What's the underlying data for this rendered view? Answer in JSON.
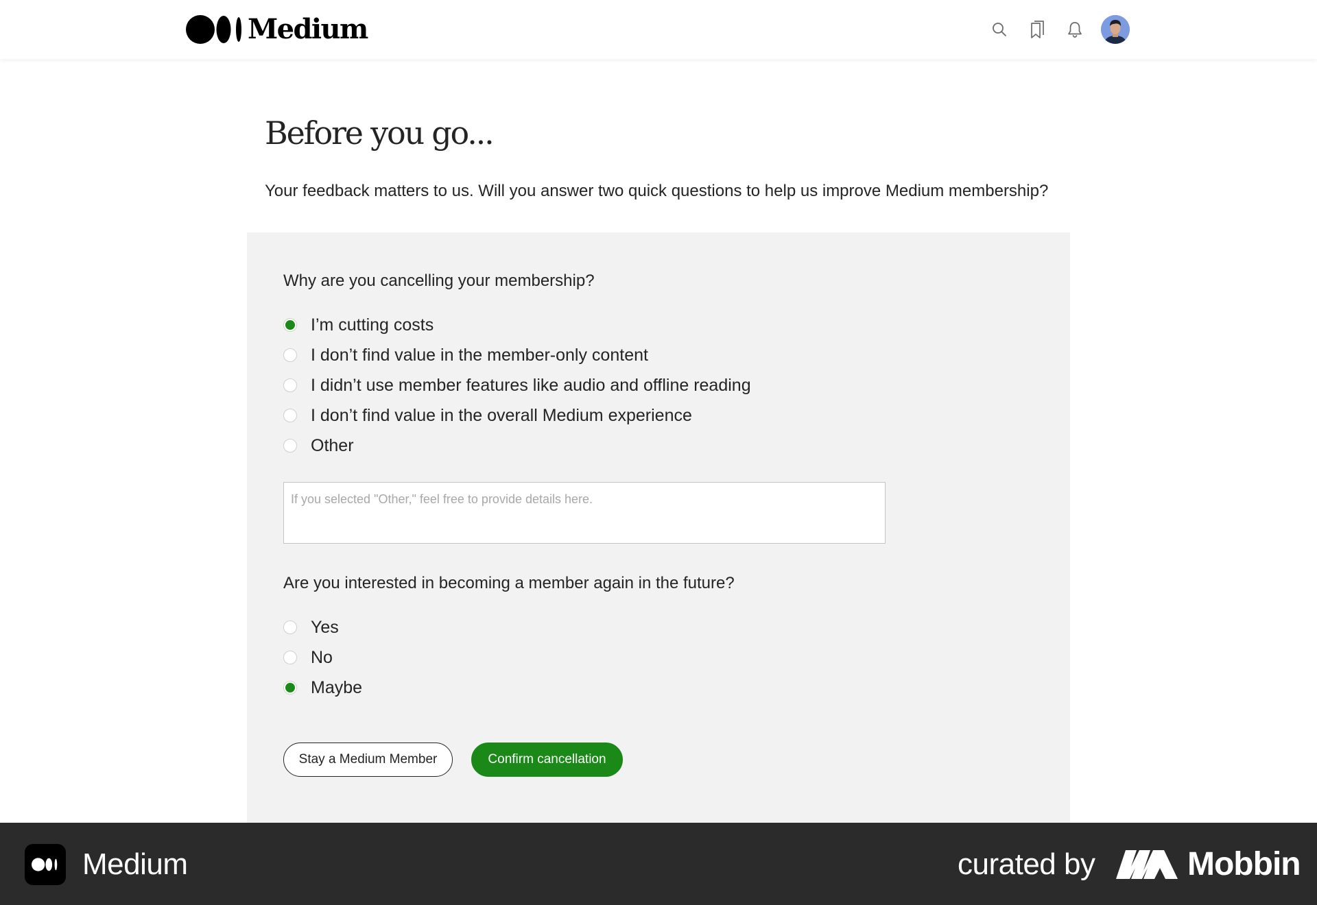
{
  "header": {
    "brand": "Medium",
    "icons": [
      "medium-logo-icon",
      "search-icon",
      "bookmarks-icon",
      "notification-bell-icon",
      "avatar"
    ]
  },
  "page": {
    "title": "Before you go...",
    "intro": "Your feedback matters to us. Will you answer two quick questions to help us improve Medium membership?"
  },
  "survey": {
    "q1": {
      "question": "Why are you cancelling your membership?",
      "options": [
        "I’m cutting costs",
        "I don’t find value in the member-only content",
        "I didn’t use member features like audio and offline reading",
        "I don’t find value in the overall Medium experience",
        "Other"
      ],
      "selected": "I’m cutting costs"
    },
    "details": {
      "placeholder": "If you selected \"Other,\" feel free to provide details here.",
      "value": ""
    },
    "q2": {
      "question": "Are you interested in becoming a member again in the future?",
      "options": [
        "Yes",
        "No",
        "Maybe"
      ],
      "selected": "Maybe"
    }
  },
  "actions": {
    "stay_label": "Stay a Medium Member",
    "confirm_label": "Confirm cancellation"
  },
  "footer": {
    "app_name": "Medium",
    "curated_by": "curated by",
    "curator": "Mobbin"
  },
  "colors": {
    "accent": "#1a8917",
    "panel": "#f2f2f2",
    "text": "#242424",
    "footer_bg": "#2b2b2b"
  }
}
